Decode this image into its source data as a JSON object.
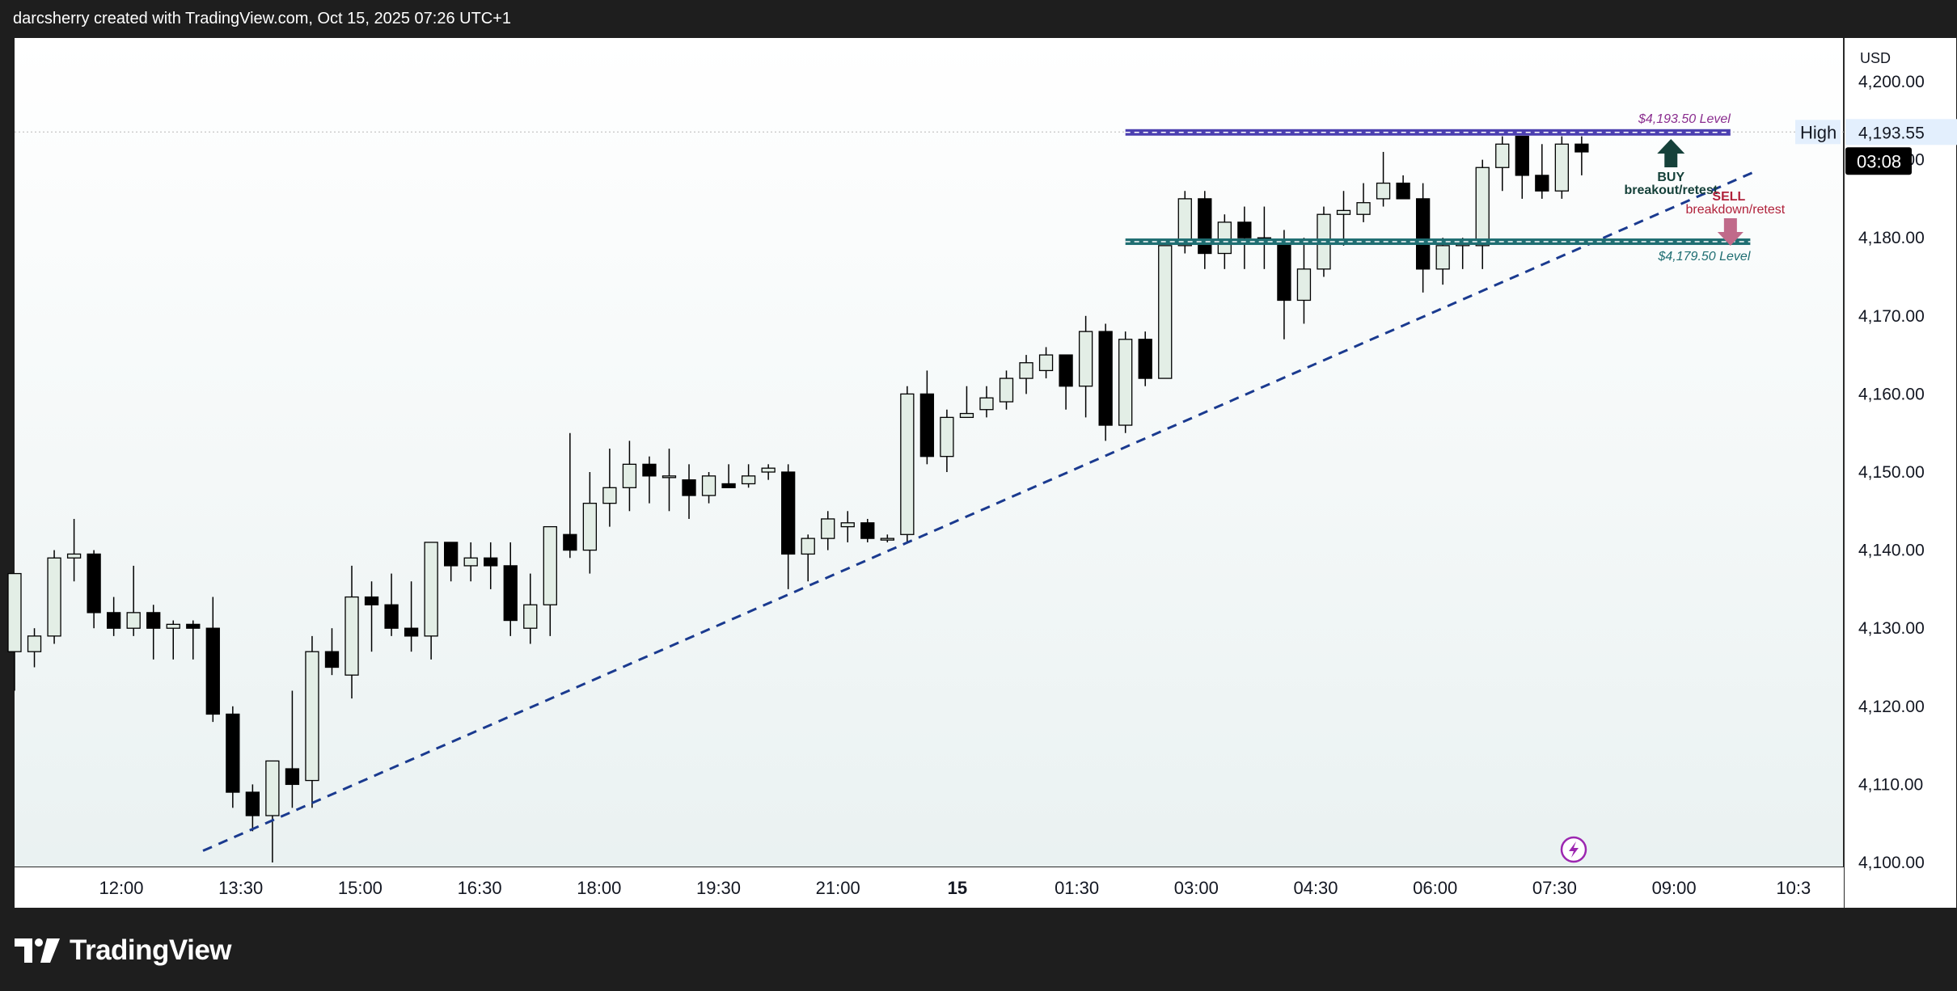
{
  "header": {
    "caption": "darcsherry created with TradingView.com, Oct 15, 2025 07:26 UTC+1"
  },
  "footer": {
    "brand": "TradingView"
  },
  "colors": {
    "background_dark": "#1e1e1e",
    "plot_top": "#ffffff",
    "plot_bottom": "#e9f1f1",
    "bull_candle": "#e3eee6",
    "bear_candle": "#000000",
    "resistance": "#4b3fb0",
    "support": "#1f6e72",
    "trendline": "#1a3a8f",
    "buy_arrow": "#16413a",
    "sell_arrow": "#c06a8a",
    "resistance_label": "#8a2d8f",
    "support_label": "#1f6e72"
  },
  "chart_data": {
    "type": "candlestick",
    "currency_label": "USD",
    "x_ticks": [
      "12:00",
      "13:30",
      "15:00",
      "16:30",
      "18:00",
      "19:30",
      "21:00",
      "15",
      "01:30",
      "03:00",
      "04:30",
      "06:00",
      "07:30",
      "09:00",
      "10:3"
    ],
    "y_ticks": [
      "4,200.00",
      "4,190.00",
      "4,180.00",
      "4,170.00",
      "4,160.00",
      "4,150.00",
      "4,140.00",
      "4,130.00",
      "4,120.00",
      "4,110.00",
      "4,100.00"
    ],
    "y_tick_values": [
      4200,
      4190,
      4180,
      4170,
      4160,
      4150,
      4140,
      4130,
      4120,
      4110,
      4100
    ],
    "ylim": [
      4099.5,
      4205
    ],
    "bar_interval_minutes": 15,
    "candles": [
      {
        "time": "11:00",
        "o": 4127,
        "h": 4137,
        "l": 4122,
        "c": 4137
      },
      {
        "time": "11:15",
        "o": 4127,
        "h": 4130,
        "l": 4125,
        "c": 4129
      },
      {
        "time": "11:30",
        "o": 4129,
        "h": 4140,
        "l": 4128,
        "c": 4139
      },
      {
        "time": "11:45",
        "o": 4139,
        "h": 4144,
        "l": 4136,
        "c": 4139.5
      },
      {
        "time": "12:00",
        "o": 4139.5,
        "h": 4140,
        "l": 4130,
        "c": 4132
      },
      {
        "time": "12:15",
        "o": 4132,
        "h": 4134,
        "l": 4129,
        "c": 4130
      },
      {
        "time": "12:30",
        "o": 4130,
        "h": 4138,
        "l": 4129,
        "c": 4132
      },
      {
        "time": "12:45",
        "o": 4132,
        "h": 4133,
        "l": 4126,
        "c": 4130
      },
      {
        "time": "13:00",
        "o": 4130,
        "h": 4131,
        "l": 4126,
        "c": 4130.5
      },
      {
        "time": "13:15",
        "o": 4130.5,
        "h": 4131,
        "l": 4126,
        "c": 4130
      },
      {
        "time": "13:30",
        "o": 4130,
        "h": 4134,
        "l": 4118,
        "c": 4119
      },
      {
        "time": "13:45",
        "o": 4119,
        "h": 4120,
        "l": 4107,
        "c": 4109
      },
      {
        "time": "14:00",
        "o": 4109,
        "h": 4110,
        "l": 4104,
        "c": 4106
      },
      {
        "time": "14:15",
        "o": 4106,
        "h": 4113,
        "l": 4100,
        "c": 4113
      },
      {
        "time": "14:30",
        "o": 4112,
        "h": 4122,
        "l": 4107,
        "c": 4110
      },
      {
        "time": "14:45",
        "o": 4110.5,
        "h": 4129,
        "l": 4107,
        "c": 4127
      },
      {
        "time": "15:00",
        "o": 4127,
        "h": 4130,
        "l": 4124,
        "c": 4125
      },
      {
        "time": "15:15",
        "o": 4124,
        "h": 4138,
        "l": 4121,
        "c": 4134
      },
      {
        "time": "15:30",
        "o": 4134,
        "h": 4136,
        "l": 4127,
        "c": 4133
      },
      {
        "time": "15:45",
        "o": 4133,
        "h": 4137,
        "l": 4129,
        "c": 4130
      },
      {
        "time": "16:00",
        "o": 4130,
        "h": 4136,
        "l": 4127,
        "c": 4129
      },
      {
        "time": "16:15",
        "o": 4129,
        "h": 4141,
        "l": 4126,
        "c": 4141
      },
      {
        "time": "16:30",
        "o": 4141,
        "h": 4141,
        "l": 4136,
        "c": 4138
      },
      {
        "time": "16:45",
        "o": 4138,
        "h": 4141,
        "l": 4136,
        "c": 4139
      },
      {
        "time": "17:00",
        "o": 4139,
        "h": 4141,
        "l": 4135,
        "c": 4138
      },
      {
        "time": "17:15",
        "o": 4138,
        "h": 4141,
        "l": 4129,
        "c": 4131
      },
      {
        "time": "17:30",
        "o": 4130,
        "h": 4137,
        "l": 4128,
        "c": 4133
      },
      {
        "time": "17:45",
        "o": 4133,
        "h": 4143,
        "l": 4129,
        "c": 4143
      },
      {
        "time": "18:00",
        "o": 4142,
        "h": 4155,
        "l": 4139,
        "c": 4140
      },
      {
        "time": "18:15",
        "o": 4140,
        "h": 4150,
        "l": 4137,
        "c": 4146
      },
      {
        "time": "18:30",
        "o": 4146,
        "h": 4153,
        "l": 4143,
        "c": 4148
      },
      {
        "time": "18:45",
        "o": 4148,
        "h": 4154,
        "l": 4145,
        "c": 4151
      },
      {
        "time": "19:00",
        "o": 4151,
        "h": 4152,
        "l": 4146,
        "c": 4149.5
      },
      {
        "time": "19:15",
        "o": 4149.5,
        "h": 4153,
        "l": 4145,
        "c": 4149.5
      },
      {
        "time": "19:30",
        "o": 4149,
        "h": 4151,
        "l": 4144,
        "c": 4147
      },
      {
        "time": "19:45",
        "o": 4147,
        "h": 4150,
        "l": 4146,
        "c": 4149.5
      },
      {
        "time": "20:00",
        "o": 4148.5,
        "h": 4151,
        "l": 4148,
        "c": 4148
      },
      {
        "time": "20:15",
        "o": 4148.5,
        "h": 4151,
        "l": 4148,
        "c": 4149.5
      },
      {
        "time": "20:30",
        "o": 4150,
        "h": 4151,
        "l": 4149,
        "c": 4150.5
      },
      {
        "time": "20:45",
        "o": 4150,
        "h": 4151,
        "l": 4135,
        "c": 4139.5
      },
      {
        "time": "21:00",
        "o": 4139.5,
        "h": 4142,
        "l": 4136,
        "c": 4141.5
      },
      {
        "time": "21:15",
        "o": 4141.5,
        "h": 4145,
        "l": 4140,
        "c": 4144
      },
      {
        "time": "21:30",
        "o": 4143,
        "h": 4145,
        "l": 4141,
        "c": 4143.5
      },
      {
        "time": "21:45",
        "o": 4143.5,
        "h": 4144,
        "l": 4141,
        "c": 4141.5
      },
      {
        "time": "22:00",
        "o": 4141.5,
        "h": 4142,
        "l": 4141,
        "c": 4141.5
      },
      {
        "time": "22:15",
        "o": 4142,
        "h": 4161,
        "l": 4141,
        "c": 4160
      },
      {
        "time": "22:30",
        "o": 4160,
        "h": 4163,
        "l": 4151,
        "c": 4152
      },
      {
        "time": "22:45",
        "o": 4152,
        "h": 4158,
        "l": 4150,
        "c": 4157
      },
      {
        "time": "23:00",
        "o": 4157,
        "h": 4161,
        "l": 4157,
        "c": 4157.5
      },
      {
        "time": "23:15",
        "o": 4158,
        "h": 4161,
        "l": 4157,
        "c": 4159.5
      },
      {
        "time": "23:30",
        "o": 4159,
        "h": 4163,
        "l": 4158,
        "c": 4162
      },
      {
        "time": "23:45",
        "o": 4162,
        "h": 4165,
        "l": 4160,
        "c": 4164
      },
      {
        "time": "00:00",
        "o": 4163,
        "h": 4166,
        "l": 4162,
        "c": 4165
      },
      {
        "time": "00:15",
        "o": 4165,
        "h": 4165,
        "l": 4158,
        "c": 4161
      },
      {
        "time": "00:30",
        "o": 4161,
        "h": 4170,
        "l": 4157,
        "c": 4168
      },
      {
        "time": "00:45",
        "o": 4168,
        "h": 4169,
        "l": 4154,
        "c": 4156
      },
      {
        "time": "01:00",
        "o": 4156,
        "h": 4168,
        "l": 4155,
        "c": 4167
      },
      {
        "time": "01:15",
        "o": 4167,
        "h": 4168,
        "l": 4161,
        "c": 4162
      },
      {
        "time": "01:30",
        "o": 4162,
        "h": 4179,
        "l": 4162,
        "c": 4179
      },
      {
        "time": "01:45",
        "o": 4179,
        "h": 4186,
        "l": 4178,
        "c": 4185
      },
      {
        "time": "02:00",
        "o": 4185,
        "h": 4186,
        "l": 4176,
        "c": 4178
      },
      {
        "time": "02:15",
        "o": 4178,
        "h": 4183,
        "l": 4176,
        "c": 4182
      },
      {
        "time": "02:30",
        "o": 4182,
        "h": 4184,
        "l": 4176,
        "c": 4180
      },
      {
        "time": "02:45",
        "o": 4180,
        "h": 4184,
        "l": 4176,
        "c": 4179.5
      },
      {
        "time": "03:00",
        "o": 4179.5,
        "h": 4181,
        "l": 4167,
        "c": 4172
      },
      {
        "time": "03:15",
        "o": 4172,
        "h": 4180,
        "l": 4169,
        "c": 4176
      },
      {
        "time": "03:30",
        "o": 4176,
        "h": 4184,
        "l": 4175,
        "c": 4183
      },
      {
        "time": "03:45",
        "o": 4183,
        "h": 4186,
        "l": 4179,
        "c": 4183.5
      },
      {
        "time": "04:00",
        "o": 4183,
        "h": 4187,
        "l": 4182,
        "c": 4184.5
      },
      {
        "time": "04:15",
        "o": 4185,
        "h": 4191,
        "l": 4184,
        "c": 4187
      },
      {
        "time": "04:30",
        "o": 4187,
        "h": 4188,
        "l": 4185,
        "c": 4185
      },
      {
        "time": "04:45",
        "o": 4185,
        "h": 4187,
        "l": 4173,
        "c": 4176
      },
      {
        "time": "05:00",
        "o": 4176,
        "h": 4180,
        "l": 4174,
        "c": 4179
      },
      {
        "time": "05:15",
        "o": 4179,
        "h": 4180,
        "l": 4176,
        "c": 4179.5
      },
      {
        "time": "05:30",
        "o": 4179,
        "h": 4190,
        "l": 4176,
        "c": 4189
      },
      {
        "time": "05:45",
        "o": 4189,
        "h": 4193,
        "l": 4186,
        "c": 4192
      },
      {
        "time": "06:00",
        "o": 4193,
        "h": 4193,
        "l": 4185,
        "c": 4188
      },
      {
        "time": "06:15",
        "o": 4188,
        "h": 4192,
        "l": 4185,
        "c": 4186
      },
      {
        "time": "06:30",
        "o": 4186,
        "h": 4193,
        "l": 4185,
        "c": 4192
      },
      {
        "time": "06:45",
        "o": 4192,
        "h": 4193,
        "l": 4188,
        "c": 4191
      }
    ],
    "levels": [
      {
        "name": "resistance",
        "label": "$4,193.50 Level",
        "value": 4193.5,
        "from_index": 56,
        "to_index": 86.5
      },
      {
        "name": "support",
        "label": "$4,179.50 Level",
        "value": 4179.5,
        "from_index": 56,
        "to_index": 87.5
      }
    ],
    "trendline": {
      "from_index": 9.5,
      "from_value": 4101.5,
      "to_index": 87.75,
      "to_value": 4188.5
    },
    "annotations": {
      "buy": {
        "line1": "BUY",
        "line2": "breakout/retest",
        "index": 83.5
      },
      "sell": {
        "line1": "SELL",
        "line2": "breakdown/retest",
        "index": 86.5
      }
    },
    "price_labels": {
      "high_tag": "High",
      "high_value": "4,193.55",
      "high_price": 4193.55,
      "countdown": "03:08"
    },
    "grid": false
  }
}
